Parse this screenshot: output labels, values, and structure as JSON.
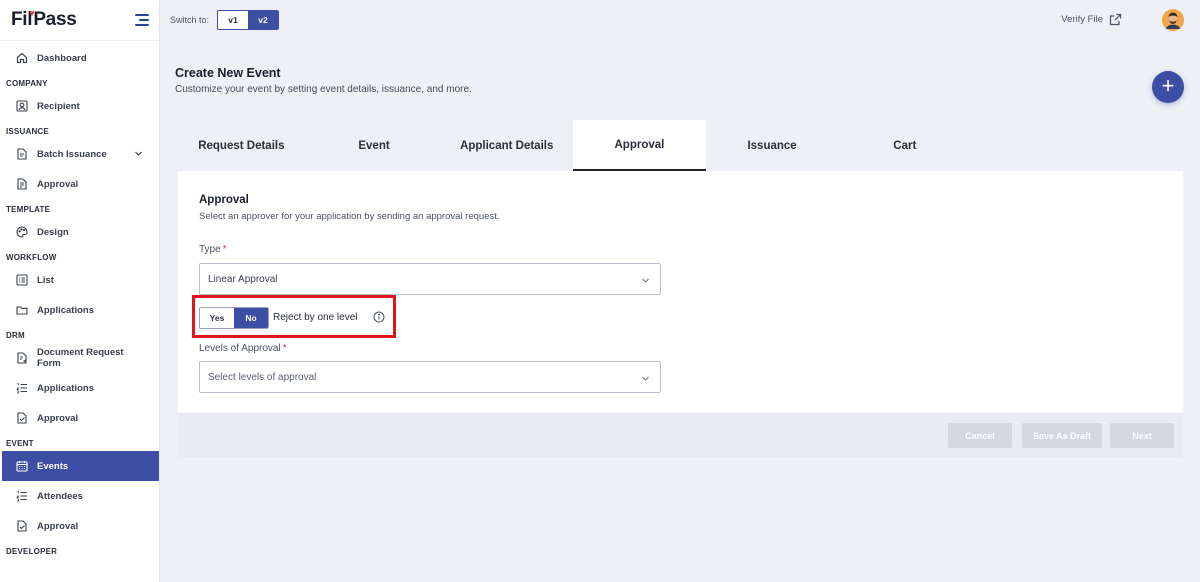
{
  "brand": {
    "logo_main": "FilPass"
  },
  "sidebar": {
    "sections": [
      {
        "items": [
          {
            "label": "Dashboard",
            "icon": "home-icon"
          }
        ]
      },
      {
        "title": "COMPANY",
        "items": [
          {
            "label": "Recipient",
            "icon": "person-card-icon"
          }
        ]
      },
      {
        "title": "ISSUANCE",
        "items": [
          {
            "label": "Batch Issuance",
            "icon": "document-add-icon",
            "chevron": true
          },
          {
            "label": "Approval",
            "icon": "document-check-icon"
          }
        ]
      },
      {
        "title": "TEMPLATE",
        "items": [
          {
            "label": "Design",
            "icon": "palette-icon"
          }
        ]
      },
      {
        "title": "WORKFLOW",
        "items": [
          {
            "label": "List",
            "icon": "list-box-icon"
          },
          {
            "label": "Applications",
            "icon": "folder-icon"
          }
        ]
      },
      {
        "title": "DRM",
        "items": [
          {
            "label": "Document Request Form",
            "icon": "document-form-icon"
          },
          {
            "label": "Applications",
            "icon": "numbered-list-icon"
          },
          {
            "label": "Approval",
            "icon": "document-check-icon"
          }
        ]
      },
      {
        "title": "EVENT",
        "items": [
          {
            "label": "Events",
            "icon": "calendar-icon",
            "active": true
          },
          {
            "label": "Attendees",
            "icon": "numbered-list-icon"
          },
          {
            "label": "Approval",
            "icon": "document-check-icon"
          }
        ]
      },
      {
        "title": "DEVELOPER",
        "items": []
      }
    ]
  },
  "topbar": {
    "switch_label": "Switch to:",
    "versions": [
      {
        "label": "v1",
        "selected": false
      },
      {
        "label": "v2",
        "selected": true
      }
    ],
    "verify_label": "Verify File"
  },
  "header": {
    "title": "Create New Event",
    "subtitle": "Customize your event by setting event details, issuance, and more."
  },
  "tabs": [
    {
      "label": "Request Details",
      "active": false
    },
    {
      "label": "Event",
      "active": false
    },
    {
      "label": "Applicant Details",
      "active": false
    },
    {
      "label": "Approval",
      "active": true
    },
    {
      "label": "Issuance",
      "active": false
    },
    {
      "label": "Cart",
      "active": false
    }
  ],
  "form": {
    "title": "Approval",
    "subtitle": "Select an approver for your application by sending an approval request.",
    "type_label": "Type",
    "type_value": "Linear Approval",
    "required_mark": "*",
    "yes_label": "Yes",
    "no_label": "No",
    "selected_option": "No",
    "reject_label": "Reject by one level",
    "levels_label": "Levels of Approval",
    "levels_placeholder": "Select levels of approval"
  },
  "footer": {
    "cancel_label": "Cancel",
    "draft_label": "Save As Draft",
    "next_label": "Next"
  },
  "colors": {
    "accent": "#3c4fa4",
    "highlight": "#e0141b",
    "disabled_button": "#d4d7de",
    "background": "#eef0f5"
  }
}
